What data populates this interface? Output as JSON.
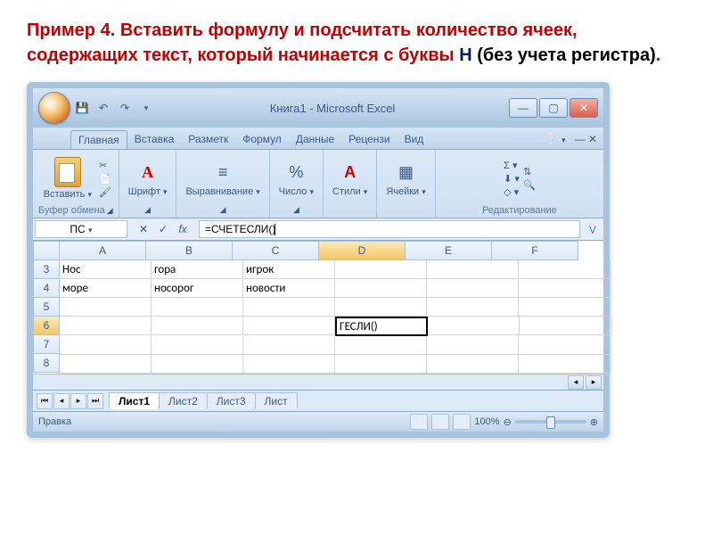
{
  "heading": {
    "part1": "Пример 4. Вставить формулу и подсчитать количество ячеек, содержащих текст, который начинается с буквы ",
    "part2": "Н",
    "part3": "  (без учета регистра)",
    "part4": "."
  },
  "window": {
    "title": "Книга1 - Microsoft Excel"
  },
  "tabs": {
    "items": [
      "Главная",
      "Вставка",
      "Разметк",
      "Формул",
      "Данные",
      "Рецензи",
      "Вид"
    ],
    "active": 0
  },
  "ribbon": {
    "clipboard": {
      "label": "Буфер обмена",
      "paste": "Вставить"
    },
    "font": {
      "label": "Шрифт",
      "icon": "А"
    },
    "align": {
      "label": "Выравнивание"
    },
    "number": {
      "label": "Число",
      "icon": "%"
    },
    "styles": {
      "label": "Стили",
      "icon": "A"
    },
    "cells": {
      "label": "Ячейки"
    },
    "editing": {
      "label": "Редактирование"
    }
  },
  "namebox": "ПС",
  "formula": "=СЧЕТЕСЛИ()",
  "columns": [
    "A",
    "B",
    "C",
    "D",
    "E",
    "F"
  ],
  "rows": [
    "3",
    "4",
    "5",
    "6",
    "7",
    "8"
  ],
  "active_col": 3,
  "active_row": 3,
  "cells": {
    "r3": [
      "Нос",
      "гора",
      "игрок",
      "",
      "",
      ""
    ],
    "r4": [
      "море",
      "носорог",
      "новости",
      "",
      "",
      ""
    ],
    "r5": [
      "",
      "",
      "",
      "",
      "",
      ""
    ],
    "r6": [
      "",
      "",
      "",
      "ГЕСЛИ()",
      "",
      ""
    ],
    "r7": [
      "",
      "",
      "",
      "",
      "",
      ""
    ],
    "r8": [
      "",
      "",
      "",
      "",
      "",
      ""
    ]
  },
  "sheets": {
    "items": [
      "Лист1",
      "Лист2",
      "Лист3",
      "Лист"
    ],
    "active": 0
  },
  "status": {
    "mode": "Правка",
    "zoom": "100%"
  }
}
